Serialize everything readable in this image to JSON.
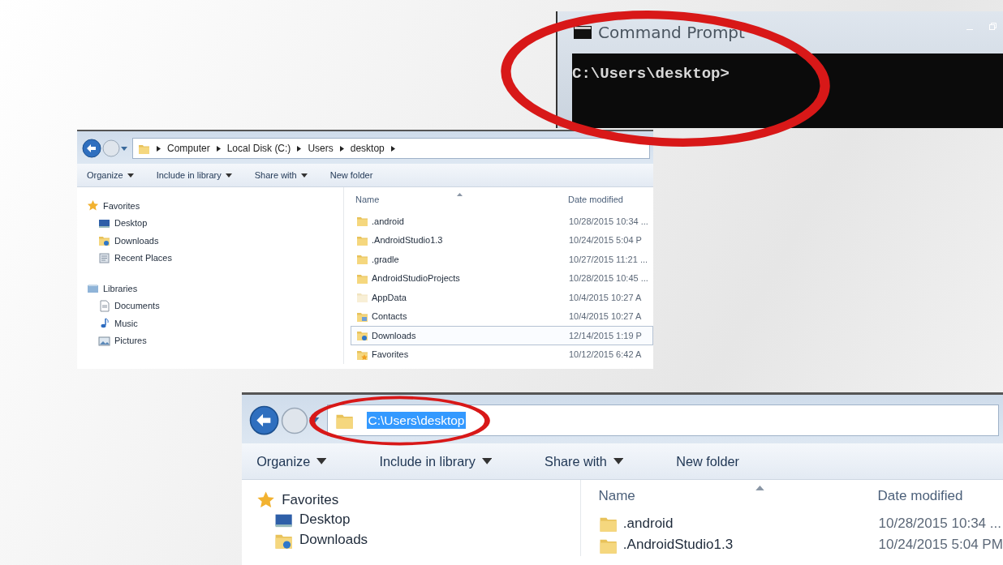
{
  "command_prompt": {
    "title": "Command Prompt",
    "lines": [
      "C:\\Users\\desktop>"
    ]
  },
  "explorer_windows": [
    {
      "address": {
        "kind": "breadcrumb",
        "segments": [
          "Computer",
          "Local Disk (C:)",
          "Users",
          "desktop"
        ]
      },
      "toolbar": [
        {
          "label": "Organize",
          "dropdown": true
        },
        {
          "label": "Include in library",
          "dropdown": true
        },
        {
          "label": "Share with",
          "dropdown": true
        },
        {
          "label": "New folder",
          "dropdown": false
        }
      ],
      "nav": [
        {
          "label": "Favorites",
          "kind": "star",
          "children": [
            {
              "label": "Desktop",
              "kind": "desktop"
            },
            {
              "label": "Downloads",
              "kind": "downloads"
            },
            {
              "label": "Recent Places",
              "kind": "recent"
            }
          ]
        },
        {
          "label": "Libraries",
          "kind": "library",
          "children": [
            {
              "label": "Documents",
              "kind": "document"
            },
            {
              "label": "Music",
              "kind": "music"
            },
            {
              "label": "Pictures",
              "kind": "pictures"
            }
          ]
        }
      ],
      "columns": [
        "Name",
        "Date modified"
      ],
      "files": [
        {
          "name": ".android",
          "date": "10/28/2015 10:34 ...",
          "kind": "folder",
          "selected": false
        },
        {
          "name": ".AndroidStudio1.3",
          "date": "10/24/2015 5:04 P",
          "kind": "folder",
          "selected": false
        },
        {
          "name": ".gradle",
          "date": "10/27/2015 11:21 ...",
          "kind": "folder",
          "selected": false
        },
        {
          "name": "AndroidStudioProjects",
          "date": "10/28/2015 10:45 ...",
          "kind": "folder",
          "selected": false
        },
        {
          "name": "AppData",
          "date": "10/4/2015 10:27 A",
          "kind": "hidden",
          "selected": false
        },
        {
          "name": "Contacts",
          "date": "10/4/2015 10:27 A",
          "kind": "contacts",
          "selected": false
        },
        {
          "name": "Downloads",
          "date": "12/14/2015 1:19 P",
          "kind": "downloads",
          "selected": true
        },
        {
          "name": "Favorites",
          "date": "10/12/2015 6:42 A",
          "kind": "favorites",
          "selected": false
        }
      ]
    },
    {
      "address": {
        "kind": "text",
        "value": "C:\\Users\\desktop",
        "text_selected": true
      },
      "toolbar": [
        {
          "label": "Organize",
          "dropdown": true
        },
        {
          "label": "Include in library",
          "dropdown": true
        },
        {
          "label": "Share with",
          "dropdown": true
        },
        {
          "label": "New folder",
          "dropdown": false
        }
      ],
      "nav": [
        {
          "label": "Favorites",
          "kind": "star",
          "children": [
            {
              "label": "Desktop",
              "kind": "desktop"
            },
            {
              "label": "Downloads",
              "kind": "downloads"
            }
          ]
        }
      ],
      "columns": [
        "Name",
        "Date modified"
      ],
      "files": [
        {
          "name": ".android",
          "date": "10/28/2015 10:34 ...",
          "kind": "folder",
          "selected": false
        },
        {
          "name": ".AndroidStudio1.3",
          "date": "10/24/2015 5:04 PM",
          "kind": "folder",
          "selected": false
        }
      ]
    }
  ]
}
